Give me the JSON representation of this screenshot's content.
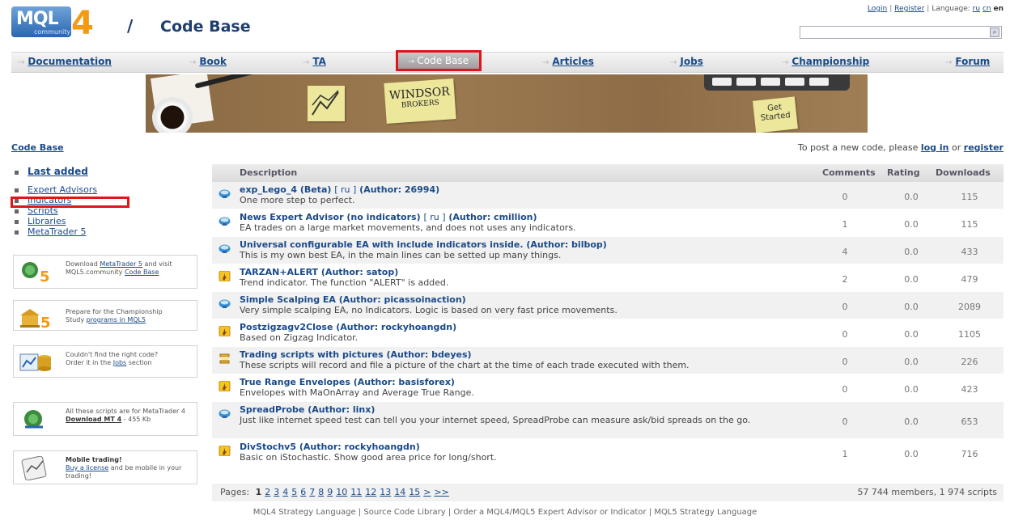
{
  "header": {
    "logo_text": "MQL",
    "logo_number": "4",
    "logo_sub": "community",
    "slash": "/",
    "title": "Code Base",
    "login": "Login",
    "register": "Register",
    "language_label": "Language:",
    "lang_ru": "ru",
    "lang_cn": "cn",
    "lang_en": "en",
    "search_placeholder": ""
  },
  "nav": [
    {
      "label": "Documentation"
    },
    {
      "label": "Book"
    },
    {
      "label": "TA"
    },
    {
      "label": "Code Base",
      "active": true
    },
    {
      "label": "Articles"
    },
    {
      "label": "Jobs"
    },
    {
      "label": "Championship"
    },
    {
      "label": "Forum"
    }
  ],
  "banner": {
    "note_brand": "WINDSOR",
    "note_brand_sub": "BROKERS",
    "note_cta": "Get Started"
  },
  "breadcrumb": "Code Base",
  "post_note": {
    "prefix": "To post a new code, please",
    "login": "log in",
    "or": "or",
    "register": "register"
  },
  "sidebar": {
    "items": [
      {
        "label": "Last added"
      },
      {
        "label": "Expert Advisors"
      },
      {
        "label": "Indicators"
      },
      {
        "label": "Scripts"
      },
      {
        "label": "Libraries"
      },
      {
        "label": "MetaTrader 5"
      }
    ],
    "promos": [
      {
        "line1": "Download",
        "link": "MetaTrader 5",
        "line2": "and visit MQL5.community",
        "link2": "Code Base"
      },
      {
        "line1": "Prepare for the Championship",
        "line2": "Study",
        "link": "programs in MQL5"
      },
      {
        "line1": "Couldn't find the right code?",
        "line2": "Order it in the",
        "link": "Jobs",
        "line3": "section"
      },
      {
        "line1": "All these scripts are for MetaTrader 4",
        "link": "Download MT 4",
        "size": "- 455 Kb"
      },
      {
        "title": "Mobile trading!",
        "link": "Buy a license",
        "line2": "and be mobile in your trading!"
      }
    ]
  },
  "table": {
    "headers": {
      "description": "Description",
      "comments": "Comments",
      "rating": "Rating",
      "downloads": "Downloads"
    },
    "rows": [
      {
        "type": "ea",
        "title": "exp_Lego_4 (Beta)",
        "ru": "[ ru ]",
        "author": "(Author: 26994)",
        "desc": "One more step to perfect.",
        "comments": "0",
        "rating": "0.0",
        "downloads": "115"
      },
      {
        "type": "ea",
        "title": "News Expert Advisor (no indicators)",
        "ru": "[ ru ]",
        "author": "(Author: cmillion)",
        "desc": "EA trades on a large market movements, and does not uses any indicators.",
        "comments": "1",
        "rating": "0.0",
        "downloads": "115"
      },
      {
        "type": "ea",
        "title": "Universal configurable EA with include indicators inside.",
        "ru": "",
        "author": "(Author: bilbop)",
        "desc": "This is my own best EA, in the main lines can be setted up many things.",
        "comments": "4",
        "rating": "0.0",
        "downloads": "433"
      },
      {
        "type": "ind",
        "title": "TARZAN+ALERT",
        "ru": "",
        "author": "(Author: satop)",
        "desc": "Trend indicator. The function \"ALERT\" is added.",
        "comments": "2",
        "rating": "0.0",
        "downloads": "479"
      },
      {
        "type": "ea",
        "title": "Simple Scalping EA",
        "ru": "",
        "author": "(Author: picassoinaction)",
        "desc": "Very simple scalping EA, no Indicators. Logic is based on very fast price movements.",
        "comments": "0",
        "rating": "0.0",
        "downloads": "2089"
      },
      {
        "type": "ind",
        "title": "Postzigzagv2Close",
        "ru": "",
        "author": "(Author: rockyhoangdn)",
        "desc": "Based on Zigzag Indicator.",
        "comments": "0",
        "rating": "0.0",
        "downloads": "1105"
      },
      {
        "type": "script",
        "title": "Trading scripts with pictures",
        "ru": "",
        "author": "(Author: bdeyes)",
        "desc": "These scripts will record and file a picture of the chart at the time of each trade executed with them.",
        "comments": "0",
        "rating": "0.0",
        "downloads": "226"
      },
      {
        "type": "ind",
        "title": "True Range Envelopes",
        "ru": "",
        "author": "(Author: basisforex)",
        "desc": "Envelopes with MaOnArray and Average True Range.",
        "comments": "0",
        "rating": "0.0",
        "downloads": "423"
      },
      {
        "type": "ea",
        "title": "SpreadProbe",
        "ru": "",
        "author": "(Author: linx)",
        "desc": "Just like internet speed test can tell you your internet speed, SpreadProbe can measure ask/bid spreads on the go.",
        "comments": "0",
        "rating": "0.0",
        "downloads": "653",
        "tall": true
      },
      {
        "type": "ind",
        "title": "DivStochv5",
        "ru": "",
        "author": "(Author: rockyhoangdn)",
        "desc": "Basic on iStochastic. Show good area price for long/short.",
        "comments": "1",
        "rating": "0.0",
        "downloads": "716"
      }
    ]
  },
  "pager": {
    "label": "Pages:",
    "current": "1",
    "pages": [
      "2",
      "3",
      "4",
      "5",
      "6",
      "7",
      "8",
      "9",
      "10",
      "11",
      "12",
      "13",
      "14",
      "15",
      ">",
      ">>"
    ],
    "stats": "57 744 members, 1 974 scripts"
  },
  "footer": "MQL4 Strategy Language | Source Code Library | Order a MQL4/MQL5 Expert Advisor or Indicator | MQL5 Strategy Language",
  "colors": {
    "link": "#1a4a8a",
    "highlight": "#e0141b",
    "logo_orange": "#f39a12",
    "logo_blue": "#2a66b0"
  }
}
